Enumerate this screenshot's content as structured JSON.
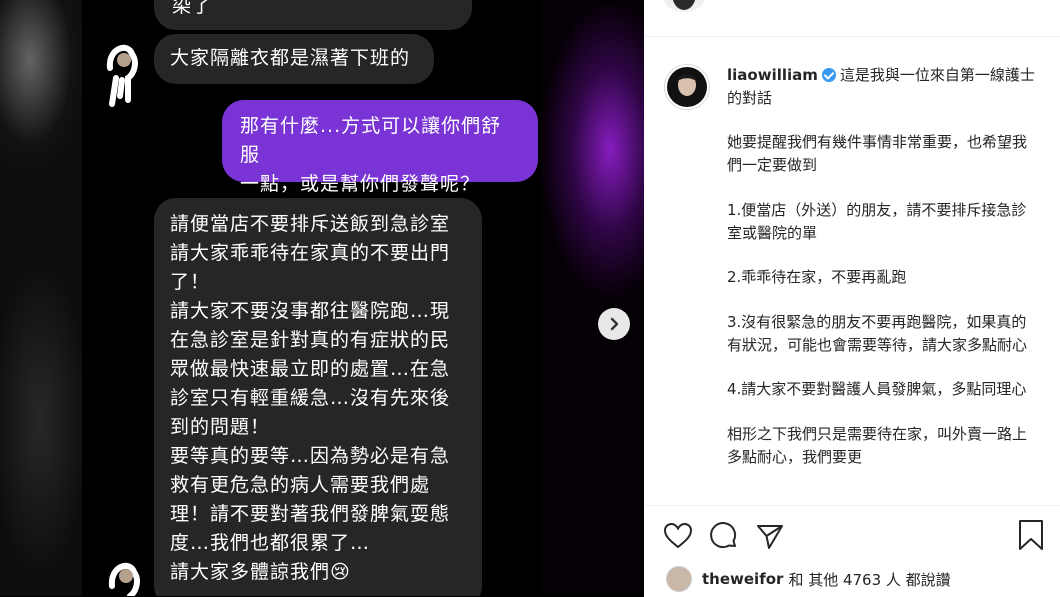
{
  "chat": {
    "bubble_top_partial": "染了",
    "bubble_1": "大家隔離衣都是濕著下班的",
    "bubble_purple_l1": "那有什麼...方式可以讓你們舒服",
    "bubble_purple_l2": "一點，或是幫你們發聲呢？",
    "long_reply": [
      "請便當店不要排斥送飯到急診室",
      "請大家乖乖待在家真的不要出門",
      "了！",
      "請大家不要沒事都往醫院跑…現",
      "在急診室是針對真的有症狀的民",
      "眾做最快速最立即的處置…在急",
      "診室只有輕重緩急…沒有先來後",
      "到的問題！",
      "要等真的要等…因為勢必是有急",
      "救有更危急的病人需要我們處",
      "理！請不要對著我們發脾氣耍態",
      "度…我們也都很累了…",
      "請大家多體諒我們😢"
    ]
  },
  "post": {
    "username": "liaowilliam",
    "caption_intro": "這是我與一位來自第一線護士的對話",
    "paragraphs": [
      "她要提醒我們有幾件事情非常重要，也希望我們一定要做到",
      "1.便當店（外送）的朋友，請不要排斥接急診室或醫院的單",
      "2.乖乖待在家，不要再亂跑",
      "3.沒有很緊急的朋友不要再跑醫院，如果真的有狀況，可能也會需要等待，請大家多點耐心",
      "4.請大家不要對醫護人員發脾氣，多點同理心",
      "相形之下我們只是需要待在家，叫外賣一路上多點耐心，我們要更"
    ]
  },
  "likes": {
    "user": "theweifor",
    "rest": "和 其他 4763 人 都說讚"
  },
  "icons": [
    "heart-icon",
    "comment-icon",
    "share-icon",
    "bookmark-icon",
    "next-arrow-icon",
    "verified-icon"
  ],
  "colors": {
    "purple_bubble": "#7a34d6",
    "gray_bubble": "#262626",
    "verified": "#3897f0"
  }
}
